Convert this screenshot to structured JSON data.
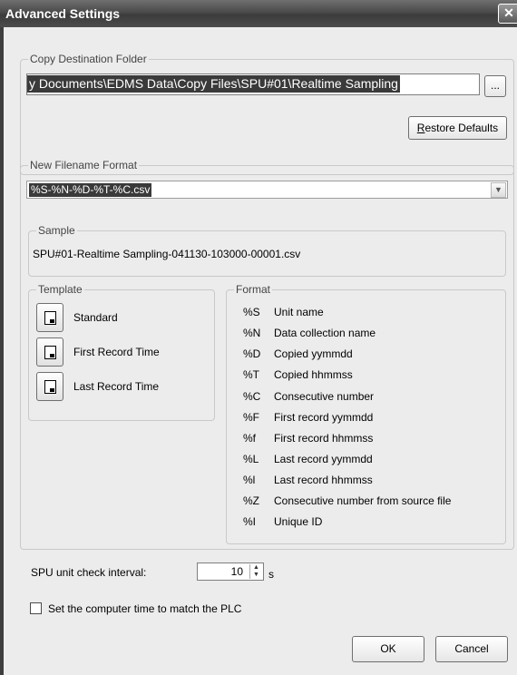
{
  "window": {
    "title": "Advanced Settings",
    "close_icon": "close-icon"
  },
  "copy_destination": {
    "group_label": "Copy Destination Folder",
    "path_value": "y Documents\\EDMS Data\\Copy Files\\SPU#01\\Realtime Sampling",
    "browse_label": "...",
    "restore_defaults_hotkey": "R",
    "restore_defaults_rest": "estore Defaults"
  },
  "filename_format": {
    "group_label": "New Filename Format",
    "selected_value": "%S-%N-%D-%T-%C.csv",
    "sample_label": "Sample",
    "sample_value": "SPU#01-Realtime Sampling-041130-103000-00001.csv"
  },
  "template": {
    "group_label": "Template",
    "items": [
      {
        "label": "Standard"
      },
      {
        "label": "First Record Time"
      },
      {
        "label": "Last Record Time"
      }
    ]
  },
  "format": {
    "group_label": "Format",
    "items": [
      {
        "code": "%S",
        "desc": "Unit name"
      },
      {
        "code": "%N",
        "desc": "Data collection name"
      },
      {
        "code": "%D",
        "desc": "Copied yymmdd"
      },
      {
        "code": "%T",
        "desc": "Copied hhmmss"
      },
      {
        "code": "%C",
        "desc": "Consecutive number"
      },
      {
        "code": "%F",
        "desc": "First record yymmdd"
      },
      {
        "code": "%f",
        "desc": "First record hhmmss"
      },
      {
        "code": "%L",
        "desc": "Last record yymmdd"
      },
      {
        "code": "%l",
        "desc": "Last record hhmmss"
      },
      {
        "code": "%Z",
        "desc": "Consecutive number from source file"
      },
      {
        "code": "%I",
        "desc": "Unique ID"
      }
    ]
  },
  "check_interval": {
    "label": "SPU unit check interval:",
    "value": "10",
    "unit": "s"
  },
  "sync_time": {
    "label": "Set the computer time to match the PLC",
    "checked": false
  },
  "buttons": {
    "ok": "OK",
    "cancel": "Cancel"
  }
}
